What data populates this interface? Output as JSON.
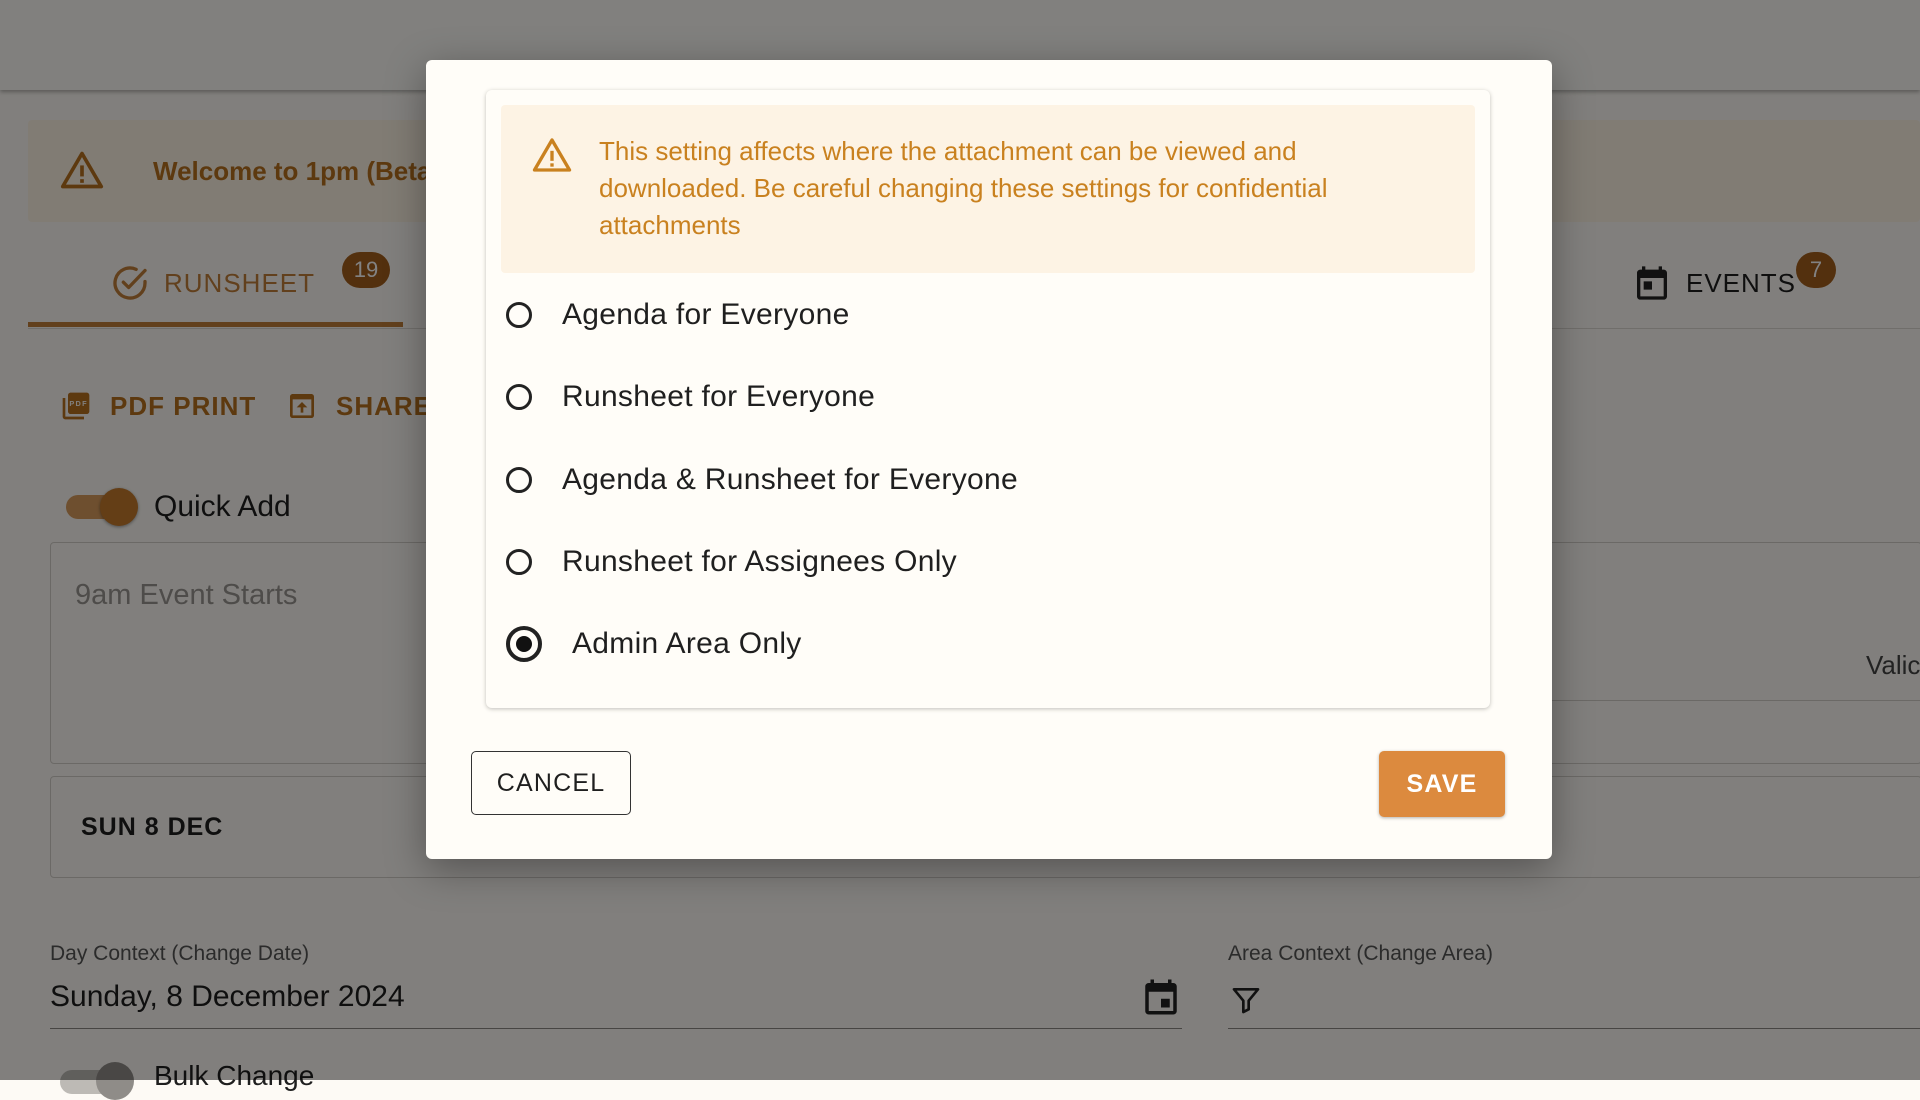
{
  "background": {
    "banner_text": "Welcome to 1pm (Beta 1.",
    "tabs": [
      {
        "label": "RUNSHEET",
        "badge": "19",
        "icon": "check-circle-icon"
      },
      {
        "label": "EVENTS",
        "badge": "7",
        "icon": "calendar-icon"
      }
    ],
    "toolbar": {
      "pdf_print_label": "PDF PRINT",
      "share_label": "SHARE"
    },
    "quick_add": {
      "label": "Quick Add",
      "enabled": true,
      "placeholder": "9am Event Starts"
    },
    "valid_label": "Valic",
    "date_header": "SUN 8 DEC",
    "day_context": {
      "label": "Day Context (Change Date)",
      "value": "Sunday, 8 December 2024"
    },
    "area_context": {
      "label": "Area Context (Change Area)"
    },
    "bulk_change": {
      "label": "Bulk Change",
      "enabled": false
    }
  },
  "dialog": {
    "warning_text": "This setting affects where the attachment can be viewed and downloaded. Be careful changing these settings for confidential attachments",
    "options": [
      {
        "label": "Agenda for Everyone",
        "selected": false
      },
      {
        "label": "Runsheet for Everyone",
        "selected": false
      },
      {
        "label": "Agenda & Runsheet for Everyone",
        "selected": false
      },
      {
        "label": "Runsheet for Assignees Only",
        "selected": false
      },
      {
        "label": "Admin Area Only",
        "selected": true
      }
    ],
    "cancel_label": "CANCEL",
    "save_label": "SAVE"
  },
  "colors": {
    "accent": "#dc8a3e",
    "tab_accent": "#c07f3a",
    "warning_text": "#c9811f",
    "warning_bg": "#fdf3e4"
  }
}
